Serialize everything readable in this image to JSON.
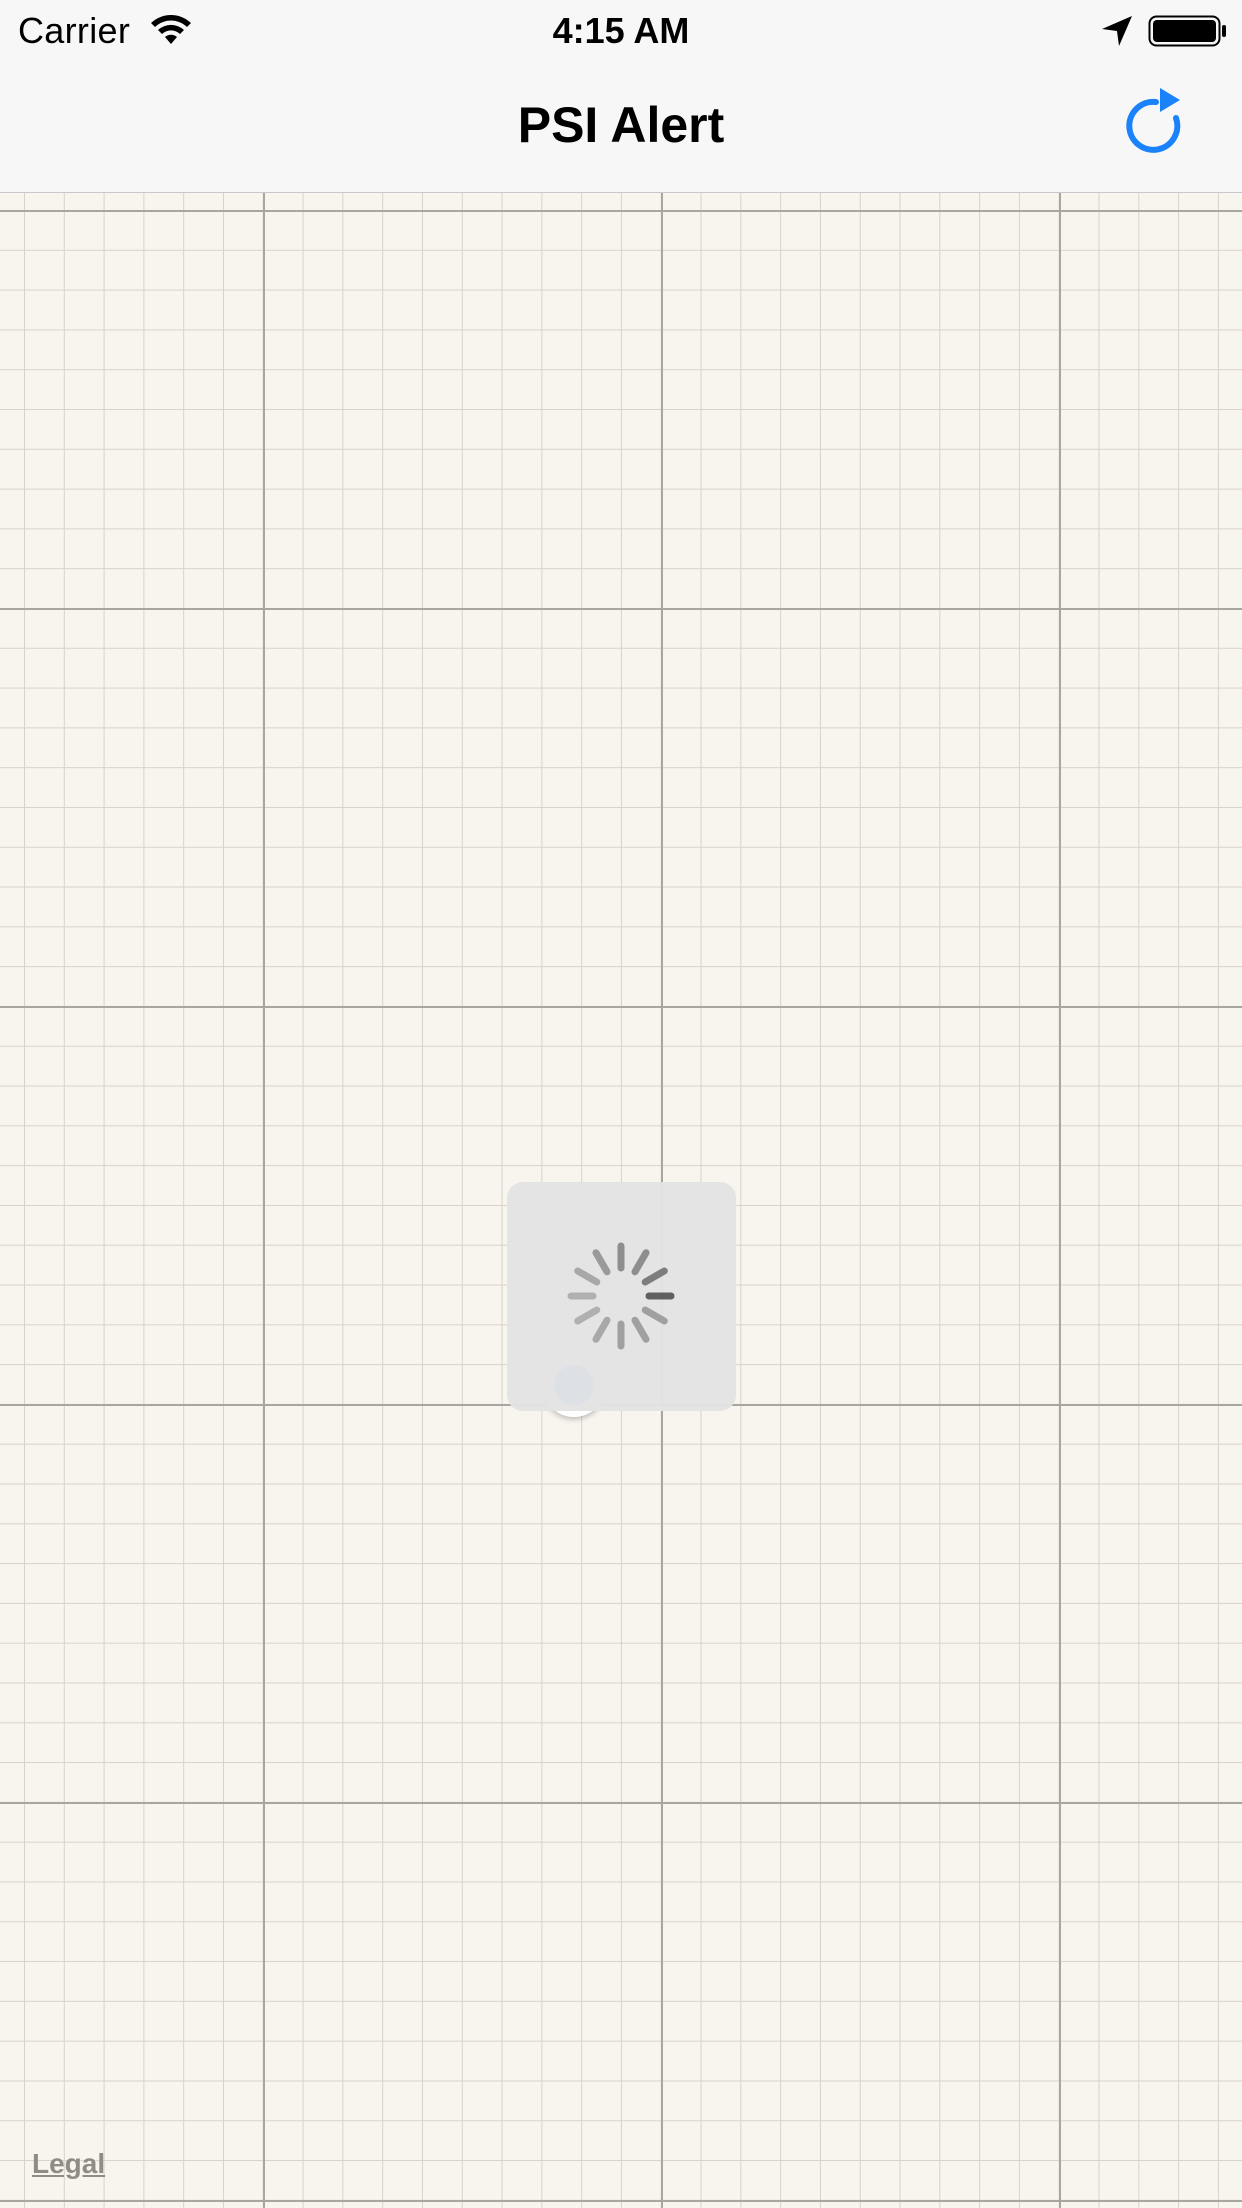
{
  "status_bar": {
    "carrier": "Carrier",
    "time": "4:15 AM",
    "icons": [
      "wifi-icon",
      "location-arrow-icon",
      "battery-icon"
    ]
  },
  "nav_bar": {
    "title": "PSI Alert",
    "right_button_icon": "refresh-icon"
  },
  "map": {
    "legal_label": "Legal",
    "loading": true
  },
  "colors": {
    "accent": "#1a82fb",
    "map_background": "#f8f4ee",
    "bar_background": "#f7f7f7"
  }
}
